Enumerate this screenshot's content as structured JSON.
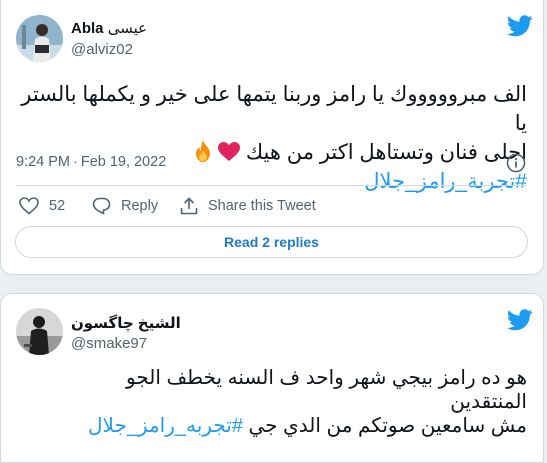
{
  "colors": {
    "accent": "#1d9bf0",
    "heart": "#e0245e",
    "text": "#0f1419",
    "muted": "#536471"
  },
  "tweet1": {
    "author_name": "Abla",
    "author_name_ar": "عيسى",
    "handle": "@alviz02",
    "text_line1": "الف مبروووووك يا رامز وربنا يتمها على خير و يكملها بالستر يا",
    "text_line2": "احلى فنان وتستاهل اكتر من هيك",
    "emoji": [
      "heart",
      "fire"
    ],
    "hashtag": "#تجربة_رامز_جلال",
    "time": "9:24 PM",
    "separator": "·",
    "date": "Feb 19, 2022",
    "like_count": "52",
    "reply_label": "Reply",
    "share_label": "Share this Tweet",
    "read_replies_label": "Read 2 replies"
  },
  "tweet2": {
    "author_name": "الشيخ چاگسون",
    "handle": "@smake97",
    "text_line1": "هو ده رامز بيجي شهر واحد ف السنه يخطف الجو",
    "text_line2": "المنتقدين",
    "text_line3": "مش سامعين صوتكم من الدي جي",
    "hashtag": "#تجربه_رامز_جلال"
  }
}
